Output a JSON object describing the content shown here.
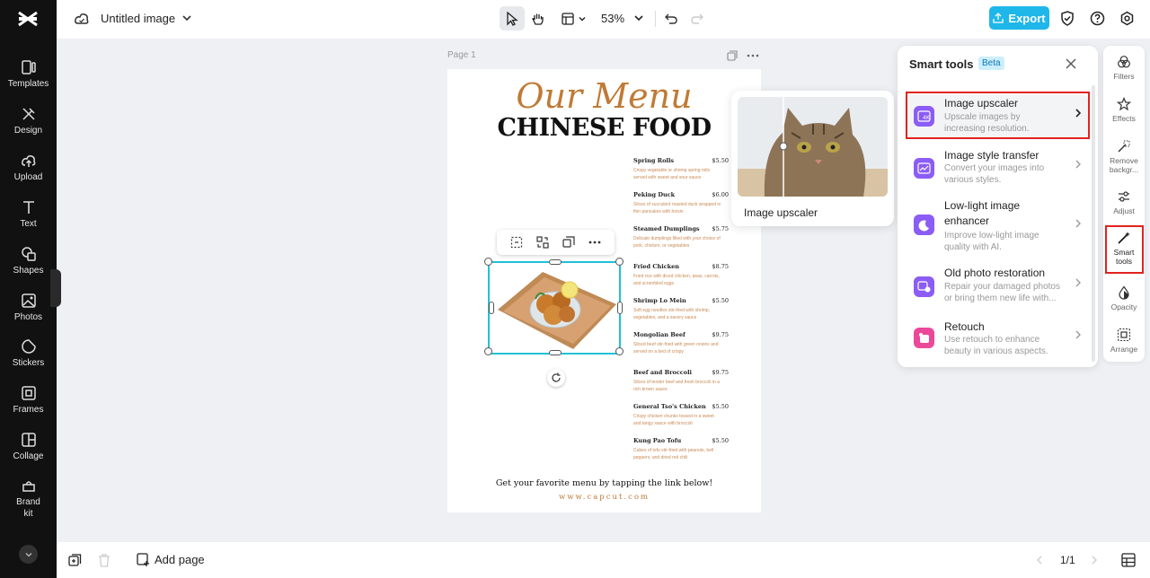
{
  "app": {
    "title": "Untitled image",
    "zoom": "53%"
  },
  "colors": {
    "accent": "#1fb7e9",
    "highlight": "#e0231f",
    "selection": "#21c1d6"
  },
  "sidebar": {
    "items": [
      {
        "label": "Templates",
        "icon": "templates-icon"
      },
      {
        "label": "Design",
        "icon": "design-icon"
      },
      {
        "label": "Upload",
        "icon": "upload-icon"
      },
      {
        "label": "Text",
        "icon": "text-icon"
      },
      {
        "label": "Shapes",
        "icon": "shapes-icon"
      },
      {
        "label": "Photos",
        "icon": "photos-icon"
      },
      {
        "label": "Stickers",
        "icon": "stickers-icon"
      },
      {
        "label": "Frames",
        "icon": "frames-icon"
      },
      {
        "label": "Collage",
        "icon": "collage-icon"
      },
      {
        "label": "Brand kit",
        "icon": "brand-kit-icon"
      }
    ]
  },
  "toolbar": {
    "export_label": "Export"
  },
  "canvas": {
    "page_label": "Page 1",
    "menu": {
      "script_title": "Our Menu",
      "title": "CHINESE FOOD",
      "items": [
        {
          "name": "Spring Rolls",
          "price": "$5.50",
          "desc": "Crispy vegetable or shrimp spring rolls served with sweet and sour sauce"
        },
        {
          "name": "Peking Duck",
          "price": "$6.00",
          "desc": "Slices of succulent roasted duck wrapped in thin pancakes with hoisin"
        },
        {
          "name": "Steamed Dumplings",
          "price": "$5.75",
          "desc": "Delicate dumplings filled with your choice of pork, chicken, or vegetables"
        },
        {
          "name": "Fried Chicken",
          "price": "$8.75",
          "desc": "Fried rice with diced chicken, peas, carrots, and scrambled eggs"
        },
        {
          "name": "Shrimp Lo Mein",
          "price": "$5.50",
          "desc": "Soft egg noodles stir-fried with shrimp, vegetables, and a savory sauce"
        },
        {
          "name": "Mongolian Beef",
          "price": "$9.75",
          "desc": "Sliced beef stir-fried with green onions and served on a bed of crispy"
        },
        {
          "name": "Beef and Broccoli",
          "price": "$9.75",
          "desc": "Slices of tender beef and fresh broccoli in a rich brown sauce"
        },
        {
          "name": "General Tso's Chicken",
          "price": "$5.50",
          "desc": "Crispy chicken chunks tossed in a sweet and tangy sauce with broccoli"
        },
        {
          "name": "Kung Pao Tofu",
          "price": "$5.50",
          "desc": "Cubes of tofu stir-fried with peanuts, bell peppers, and dried red chili"
        }
      ],
      "footer": "Get your favorite menu by tapping the link below!",
      "url": "www.capcut.com"
    }
  },
  "preview": {
    "title": "Image upscaler"
  },
  "smart_tools": {
    "title": "Smart tools",
    "badge": "Beta",
    "tools": [
      {
        "name": "Image upscaler",
        "desc": "Upscale images by increasing resolution.",
        "icon": "upscaler-icon"
      },
      {
        "name": "Image style transfer",
        "desc": "Convert your images into various styles.",
        "icon": "style-transfer-icon"
      },
      {
        "name": "Low-light image enhancer",
        "desc": "Improve low-light image quality with AI.",
        "icon": "low-light-icon"
      },
      {
        "name": "Old photo restoration",
        "desc": "Repair your damaged photos or bring them new life with...",
        "icon": "restoration-icon"
      },
      {
        "name": "Retouch",
        "desc": "Use retouch to enhance beauty in various aspects.",
        "icon": "retouch-icon"
      }
    ]
  },
  "rail": {
    "items": [
      {
        "label": "Filters"
      },
      {
        "label": "Effects"
      },
      {
        "label": "Remove backgr..."
      },
      {
        "label": "Adjust"
      },
      {
        "label": "Smart tools"
      },
      {
        "label": "Opacity"
      },
      {
        "label": "Arrange"
      }
    ]
  },
  "bottom": {
    "add_page_label": "Add page",
    "page_count": "1/1"
  }
}
